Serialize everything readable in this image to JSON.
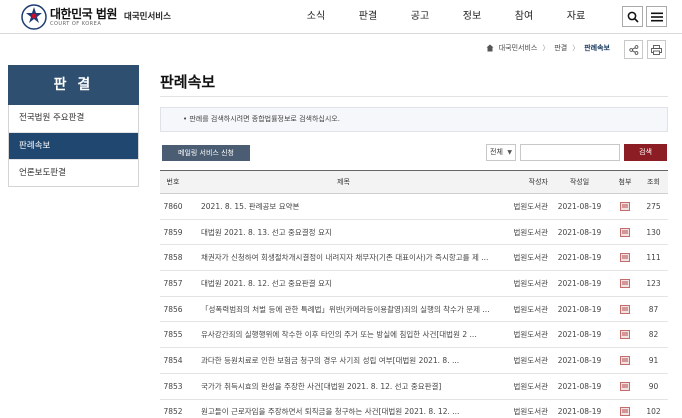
{
  "header": {
    "brand_name": "대한민국 법원",
    "brand_sub": "COURT OF KOREA",
    "service_name": "대국민서비스",
    "nav": [
      "소식",
      "판결",
      "공고",
      "정보",
      "참여",
      "자료"
    ],
    "icons": {
      "search": "search-icon",
      "menu": "hamburger-menu-icon",
      "logo": "court-emblem-icon"
    }
  },
  "breadcrumb": {
    "items": [
      "대국민서비스",
      "판결",
      "판례속보"
    ],
    "icons": {
      "home": "home-icon",
      "share": "share-icon",
      "print": "print-icon"
    }
  },
  "sidebar": {
    "title": "판 결",
    "items": [
      {
        "label": "전국법원 주요판결",
        "active": false
      },
      {
        "label": "판례속보",
        "active": true
      },
      {
        "label": "언론보도판결",
        "active": false
      }
    ]
  },
  "main": {
    "title": "판례속보",
    "notice": "• 판례를 검색하시려면 종합법률정보로 검색하십시오.",
    "mail_button": "메일링 서비스 신청",
    "search": {
      "select_value": "전체",
      "input_value": "",
      "button": "검색"
    }
  },
  "table": {
    "headers": {
      "no": "번호",
      "title": "제목",
      "author": "작성자",
      "date": "작성일",
      "file": "첨부",
      "views": "조회"
    },
    "rows": [
      {
        "no": "7860",
        "title": "2021. 8. 15. 판례공보 요약본",
        "author": "법원도서관",
        "date": "2021-08-19",
        "views": "275"
      },
      {
        "no": "7859",
        "title": "대법원 2021. 8. 13. 선고 중요결정 요지",
        "author": "법원도서관",
        "date": "2021-08-19",
        "views": "130"
      },
      {
        "no": "7858",
        "title": "채권자가 신청하여 회생절차개시결정이 내려지자 채무자(기존 대표이사)가 즉시항고를 제 ...",
        "author": "법원도서관",
        "date": "2021-08-19",
        "views": "111"
      },
      {
        "no": "7857",
        "title": "대법원 2021. 8. 12. 선고 중요판결 요지",
        "author": "법원도서관",
        "date": "2021-08-19",
        "views": "123"
      },
      {
        "no": "7856",
        "title": "「성폭력범죄의 처벌 등에 관한 특례법」위반(카메라등이용촬영)죄의 실행의 착수가 문제 ...",
        "author": "법원도서관",
        "date": "2021-08-19",
        "views": "87"
      },
      {
        "no": "7855",
        "title": "유사강간죄의 실행행위에 착수한 이후 타인의 주거 또는 방실에 침입한 사건[대법원 2 ...",
        "author": "법원도서관",
        "date": "2021-08-19",
        "views": "82"
      },
      {
        "no": "7854",
        "title": "과다한 등원치료로 인한 보험금 청구의 경우 사기죄 성립 여부[대법원 2021. 8. ...",
        "author": "법원도서관",
        "date": "2021-08-19",
        "views": "91"
      },
      {
        "no": "7853",
        "title": "국가가 취득시효의 완성을 주장한 사건[대법원 2021. 8. 12. 선고 중요판결]",
        "author": "법원도서관",
        "date": "2021-08-19",
        "views": "90"
      },
      {
        "no": "7852",
        "title": "원고들이 근로자임을 주장하면서 퇴직금을 청구하는 사건[대법원 2021. 8. 12. ...",
        "author": "법원도서관",
        "date": "2021-08-19",
        "views": "102"
      }
    ],
    "file_icon": "attachment-file-icon"
  }
}
